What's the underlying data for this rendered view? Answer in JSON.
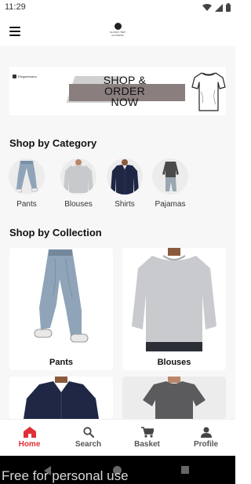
{
  "status_bar": {
    "time": "11:29"
  },
  "brand": {
    "logo_text": "GLOSSY TRIP CLOTHING"
  },
  "banner": {
    "brand_text": "Elegantmana",
    "headline": "SHOP & ORDER NOW"
  },
  "categories": {
    "title": "Shop by Category",
    "items": [
      {
        "label": "Pants",
        "icon": "pants-photo"
      },
      {
        "label": "Blouses",
        "icon": "sweater-photo"
      },
      {
        "label": "Shirts",
        "icon": "shirt-photo"
      },
      {
        "label": "Pajamas",
        "icon": "pajama-photo"
      }
    ]
  },
  "collections": {
    "title": "Shop by Collection",
    "items": [
      {
        "label": "Pants"
      },
      {
        "label": "Blouses"
      },
      {
        "label": ""
      },
      {
        "label": ""
      }
    ]
  },
  "bottom_nav": {
    "active": "home",
    "accent_color": "#e03037",
    "items": [
      {
        "label": "Home",
        "icon": "home-icon"
      },
      {
        "label": "Search",
        "icon": "search-icon"
      },
      {
        "label": "Basket",
        "icon": "cart-icon"
      },
      {
        "label": "Profile",
        "icon": "person-icon"
      }
    ]
  },
  "watermark": {
    "text": "Free for personal use"
  }
}
